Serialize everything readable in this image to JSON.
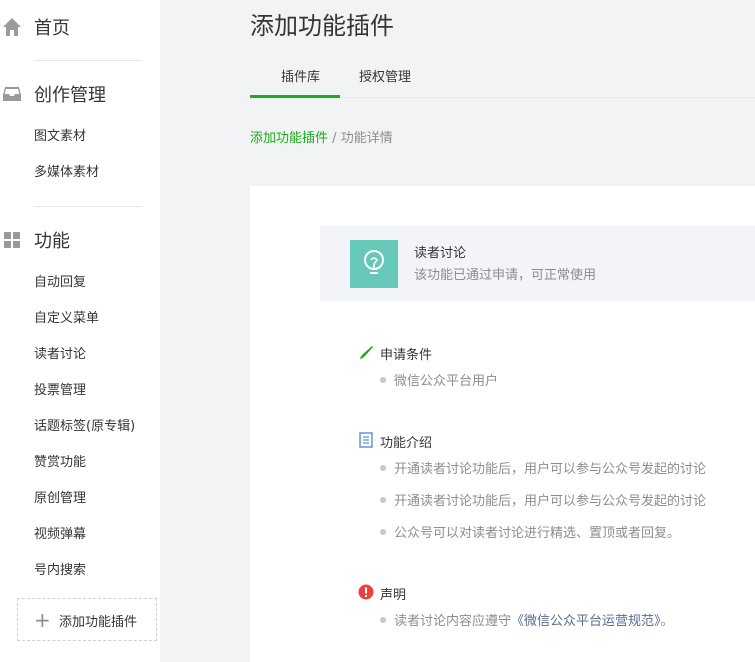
{
  "sidebar": {
    "home": {
      "label": "首页",
      "icon": "home-icon"
    },
    "creation": {
      "label": "创作管理",
      "icon": "inbox-icon",
      "items": [
        {
          "label": "图文素材"
        },
        {
          "label": "多媒体素材"
        }
      ]
    },
    "features": {
      "label": "功能",
      "icon": "grid-icon",
      "items": [
        {
          "label": "自动回复"
        },
        {
          "label": "自定义菜单"
        },
        {
          "label": "读者讨论"
        },
        {
          "label": "投票管理"
        },
        {
          "label": "话题标签(原专辑)"
        },
        {
          "label": "赞赏功能"
        },
        {
          "label": "原创管理"
        },
        {
          "label": "视频弹幕"
        },
        {
          "label": "号内搜索"
        }
      ]
    },
    "add_plugin": {
      "label": "添加功能插件",
      "icon": "plus-icon"
    }
  },
  "main": {
    "title": "添加功能插件",
    "tabs": [
      {
        "label": "插件库",
        "active": true
      },
      {
        "label": "授权管理",
        "active": false
      }
    ],
    "breadcrumb": {
      "link": "添加功能插件",
      "separator": "/",
      "current": "功能详情"
    },
    "plugin": {
      "icon": "lightbulb-icon",
      "name": "读者讨论",
      "status": "该功能已通过申请，可正常使用"
    },
    "sections": {
      "requirements": {
        "title": "申请条件",
        "icon": "pen-icon",
        "items": [
          "微信公众平台用户"
        ]
      },
      "intro": {
        "title": "功能介绍",
        "icon": "document-icon",
        "items": [
          "开通读者讨论功能后，用户可以参与公众号发起的讨论",
          "开通读者讨论功能后，用户可以参与公众号发起的讨论",
          "公众号可以对读者讨论进行精选、置顶或者回复。"
        ]
      },
      "statement": {
        "title": "声明",
        "icon": "alert-icon",
        "prefix": "读者讨论内容应遵守",
        "link": "《微信公众平台运营规范》",
        "suffix": "。"
      }
    }
  },
  "colors": {
    "accent": "#1aad19",
    "plugin_icon_bg": "#66c8b8",
    "alert": "#e64340",
    "link": "#576b95"
  }
}
